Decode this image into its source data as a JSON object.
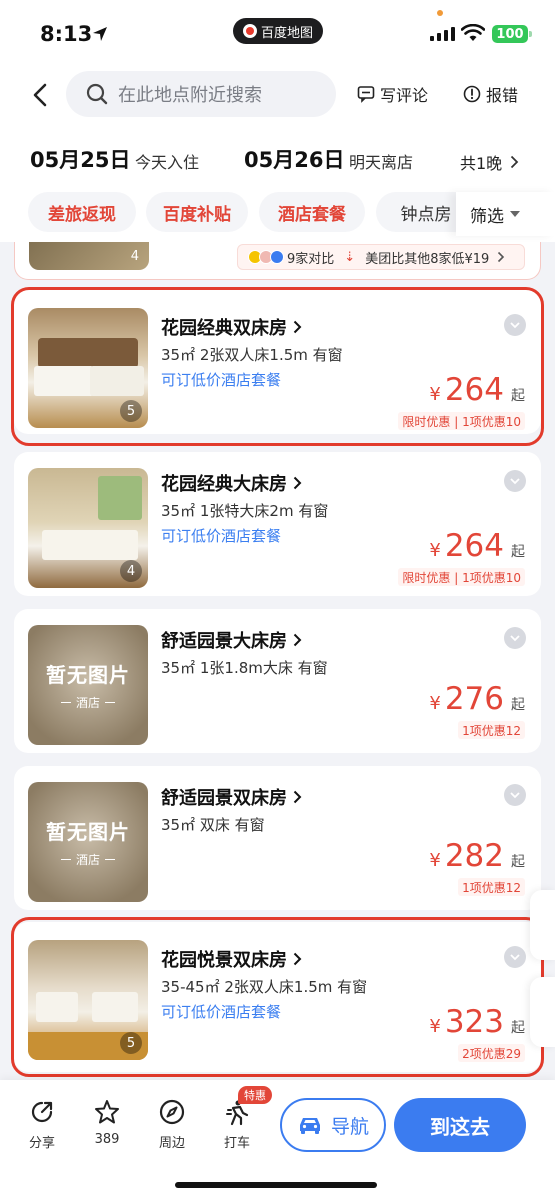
{
  "status": {
    "time": "8:13",
    "app_pill": "百度地图",
    "battery": "100"
  },
  "header": {
    "search_placeholder": "在此地点附近搜索",
    "write_review": "写评论",
    "report": "报错"
  },
  "dates": {
    "checkin_date": "05月25日",
    "checkin_label": "今天入住",
    "checkout_date": "05月26日",
    "checkout_label": "明天离店",
    "nights": "共1晚"
  },
  "chips": [
    "差旅返现",
    "百度补贴",
    "酒店套餐",
    "钟点房"
  ],
  "filter_label": "筛选",
  "prev_card": {
    "photo_count": "4",
    "compare_text": "9家对比",
    "compare_detail": "美团比其他8家低¥19"
  },
  "rooms": [
    {
      "title": "花园经典双床房",
      "spec": "35㎡ 2张双人床1.5m 有窗",
      "package": "可订低价酒店套餐",
      "currency": "¥",
      "price": "264",
      "suffix": "起",
      "promo": "限时优惠 | 1项优惠10",
      "photo_count": "5",
      "highlighted": true
    },
    {
      "title": "花园经典大床房",
      "spec": "35㎡ 1张特大床2m 有窗",
      "package": "可订低价酒店套餐",
      "currency": "¥",
      "price": "264",
      "suffix": "起",
      "promo": "限时优惠 | 1项优惠10",
      "photo_count": "4",
      "highlighted": false
    },
    {
      "title": "舒适园景大床房",
      "spec": "35㎡ 1张1.8m大床 有窗",
      "package": "",
      "currency": "¥",
      "price": "276",
      "suffix": "起",
      "promo": "1项优惠12",
      "no_image_title": "暂无图片",
      "no_image_sub": "酒店",
      "highlighted": false
    },
    {
      "title": "舒适园景双床房",
      "spec": "35㎡ 双床 有窗",
      "package": "",
      "currency": "¥",
      "price": "282",
      "suffix": "起",
      "promo": "1项优惠12",
      "no_image_title": "暂无图片",
      "no_image_sub": "酒店",
      "highlighted": false
    },
    {
      "title": "花园悦景双床房",
      "spec": "35-45㎡ 2张双人床1.5m 有窗",
      "package": "可订低价酒店套餐",
      "currency": "¥",
      "price": "323",
      "suffix": "起",
      "promo": "2项优惠29",
      "photo_count": "5",
      "highlighted": true
    }
  ],
  "bottom": {
    "share": "分享",
    "favorite_count": "389",
    "nearby": "周边",
    "taxi": "打车",
    "special_badge": "特惠",
    "navigate": "导航",
    "go_here": "到这去"
  },
  "colors": {
    "accent_blue": "#3b7cf0",
    "price_red": "#e24638",
    "highlight_red": "#e23b2c"
  }
}
